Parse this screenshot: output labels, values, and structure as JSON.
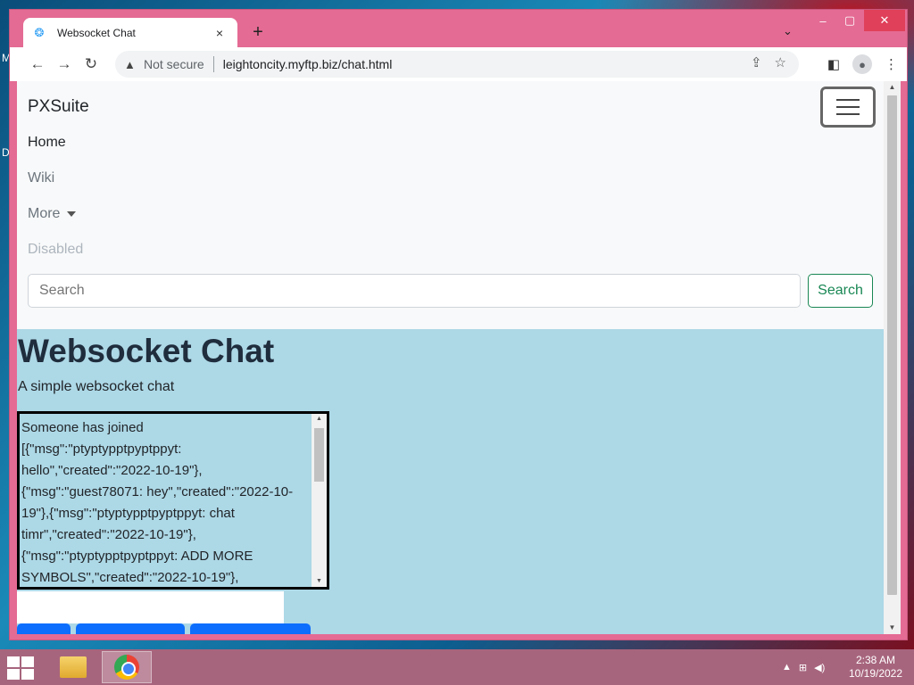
{
  "browser": {
    "tab_title": "Websocket Chat",
    "tab_close": "×",
    "new_tab": "+",
    "tab_list": "⌄",
    "win_min": "–",
    "win_max": "▢",
    "win_close": "✕",
    "security_label": "Not secure",
    "url": "leightoncity.myftp.biz/chat.html"
  },
  "page": {
    "brand": "PXSuite",
    "nav": {
      "home": "Home",
      "wiki": "Wiki",
      "more": "More",
      "disabled": "Disabled"
    },
    "search": {
      "placeholder": "Search",
      "button": "Search"
    },
    "heading": "Websocket Chat",
    "subtitle": "A simple websocket chat",
    "chat_log": "Someone has joined\n[{\"msg\":\"ptyptypptpyptppyt:\nhello\",\"created\":\"2022-10-19\"},\n{\"msg\":\"guest78071: hey\",\"created\":\"2022-10-\n19\"},{\"msg\":\"ptyptypptpyptppyt: chat\ntimr\",\"created\":\"2022-10-19\"},\n{\"msg\":\"ptyptypptpyptppyt: ADD MORE\nSYMBOLS\",\"created\":\"2022-10-19\"},"
  },
  "taskbar": {
    "time": "2:38 AM",
    "date": "10/19/2022"
  },
  "colors": {
    "window_frame": "#e46b94",
    "content_bg": "#add8e6",
    "navbar_bg": "#f8f9fa",
    "search_button": "#198754",
    "primary_button": "#0d6efd",
    "taskbar": "#a7657d"
  },
  "icons": [
    "favicon-icon",
    "back-icon",
    "forward-icon",
    "reload-icon",
    "warning-icon",
    "share-icon",
    "star-icon",
    "sidepanel-icon",
    "profile-icon",
    "menu-icon",
    "hamburger-icon",
    "windows-start-icon",
    "file-explorer-icon",
    "chrome-icon"
  ]
}
